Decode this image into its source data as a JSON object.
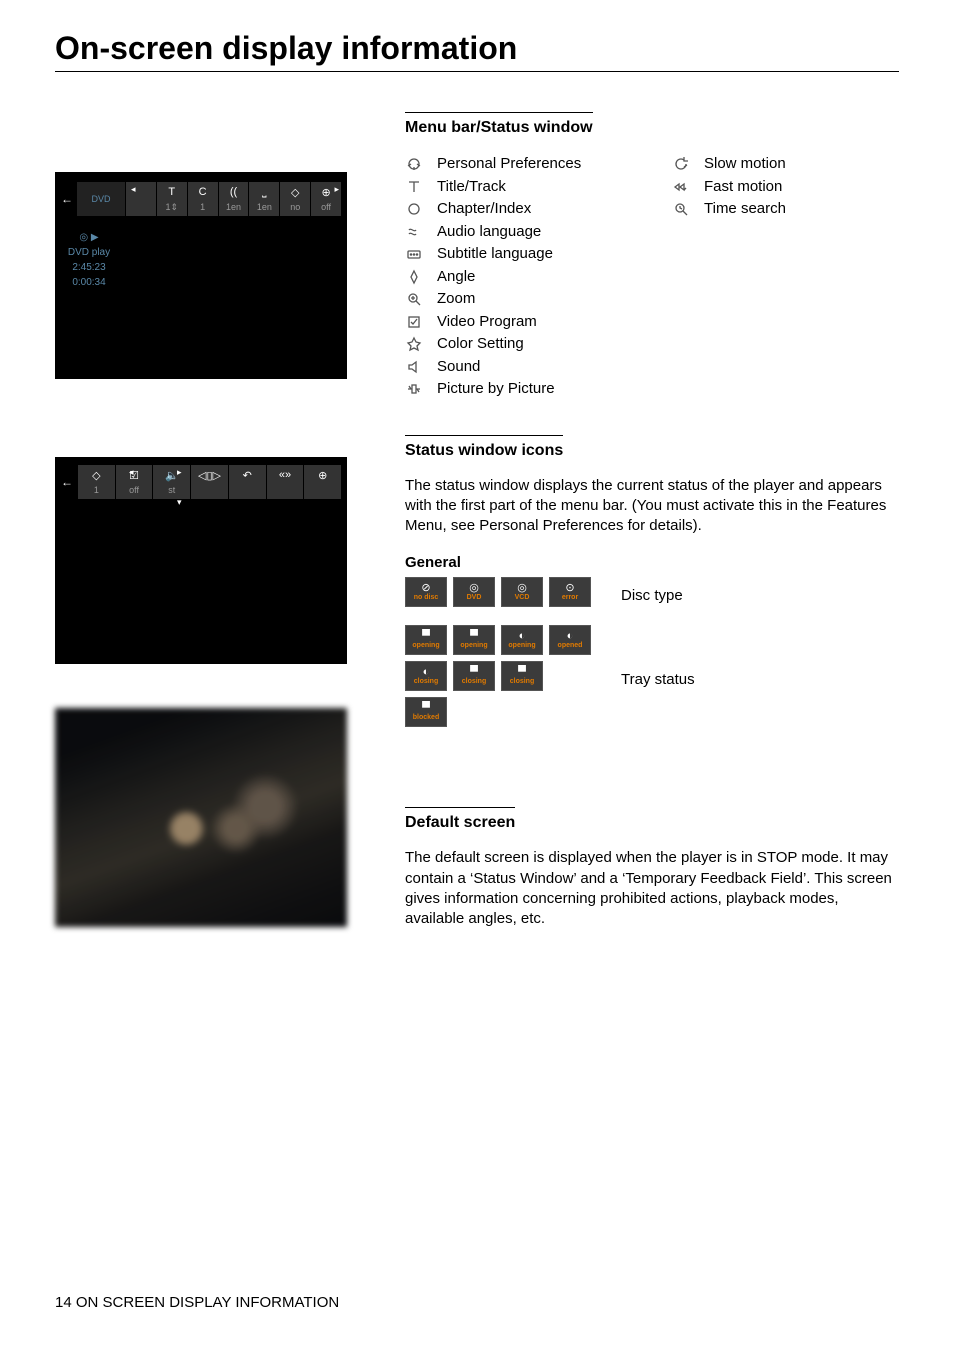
{
  "page": {
    "title": "On-screen display information",
    "footer": "14 ON SCREEN DISPLAY INFORMATION"
  },
  "menubar_section": {
    "heading": "Menu bar/Status window",
    "col1": [
      {
        "label": "Personal Preferences"
      },
      {
        "label": "Title/Track"
      },
      {
        "label": "Chapter/Index"
      },
      {
        "label": "Audio language"
      },
      {
        "label": "Subtitle language"
      },
      {
        "label": "Angle"
      },
      {
        "label": "Zoom"
      },
      {
        "label": "Video Program"
      },
      {
        "label": "Color Setting"
      },
      {
        "label": "Sound"
      },
      {
        "label": "Picture by Picture"
      }
    ],
    "col2": [
      {
        "label": "Slow motion"
      },
      {
        "label": "Fast motion"
      },
      {
        "label": "Time search"
      }
    ]
  },
  "osd1": {
    "left_label": "DVD",
    "cells": [
      {
        "top": "",
        "bot": ""
      },
      {
        "top": "T",
        "bot": "1⇕"
      },
      {
        "top": "C",
        "bot": "1"
      },
      {
        "top": "((",
        "bot": "1en"
      },
      {
        "top": "⎵",
        "bot": "1en"
      },
      {
        "top": "◇",
        "bot": "no"
      },
      {
        "top": "⊕",
        "bot": "off"
      }
    ],
    "status": {
      "line1": "◎ ▶",
      "line2": "DVD  play",
      "line3": "2:45:23",
      "line4": "0:00:34"
    }
  },
  "osd2": {
    "cells": [
      {
        "top": "◇",
        "bot": "1"
      },
      {
        "top": "☑",
        "bot": "off"
      },
      {
        "top": "🔈",
        "bot": "st"
      },
      {
        "top": "◁▯▷",
        "bot": ""
      },
      {
        "top": "↶",
        "bot": ""
      },
      {
        "top": "«»",
        "bot": ""
      },
      {
        "top": "⊕",
        "bot": ""
      }
    ]
  },
  "status_section": {
    "heading": "Status window icons",
    "body": "The status window displays the current status of the player and appears with the first part of the menu bar. (You must activate this in the Features Menu, see Personal Preferences for details).",
    "general_heading": "General",
    "disc_row": {
      "tiles": [
        {
          "icon": "⊘",
          "lbl": "no disc"
        },
        {
          "icon": "◎",
          "lbl": "DVD"
        },
        {
          "icon": "◎",
          "lbl": "VCD"
        },
        {
          "icon": "⊙",
          "lbl": "error"
        }
      ],
      "label": "Disc type"
    },
    "tray_rows": {
      "tiles_r1": [
        {
          "icon": "▀",
          "lbl": "opening"
        },
        {
          "icon": "▀",
          "lbl": "opening"
        },
        {
          "icon": "◐",
          "lbl": "opening"
        },
        {
          "icon": "◐",
          "lbl": "opened"
        }
      ],
      "tiles_r2": [
        {
          "icon": "◐",
          "lbl": "closing"
        },
        {
          "icon": "▀",
          "lbl": "closing"
        },
        {
          "icon": "▀",
          "lbl": "closing"
        }
      ],
      "tiles_r3": [
        {
          "icon": "▀",
          "lbl": "blocked"
        }
      ],
      "label": "Tray status"
    }
  },
  "default_section": {
    "heading": "Default screen",
    "body": "The default screen is displayed when the player is in STOP mode. It may contain a ‘Status Window’ and a ‘Temporary Feedback Field’. This screen gives information concerning prohibited actions, playback modes, available angles, etc."
  }
}
